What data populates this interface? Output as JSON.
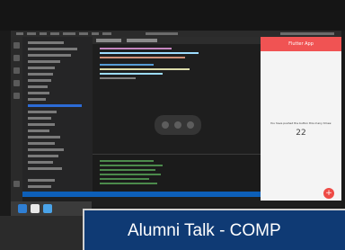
{
  "phone_app": {
    "title": "Flutter App",
    "count_label": "You have pushed the button this many times:",
    "count_value": "22",
    "fab_symbol": "+"
  },
  "banner": {
    "text": "Alumni Talk - COMP"
  },
  "colors": {
    "app_accent": "#f05353",
    "banner_bg": "#0f3a74",
    "status_bar": "#0d5fb8"
  },
  "icons": [
    "vscode-icon",
    "chrome-icon",
    "finder-icon"
  ]
}
